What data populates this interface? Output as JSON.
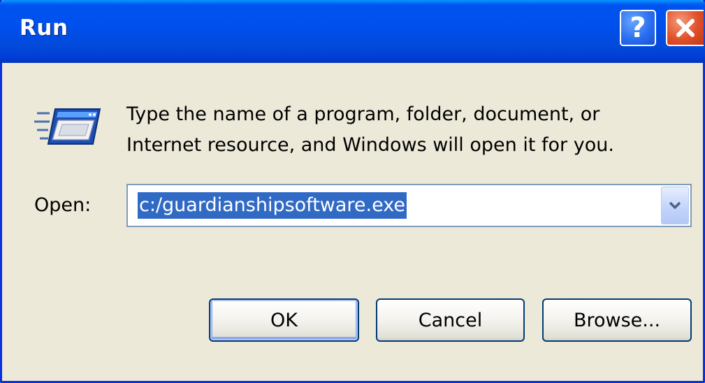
{
  "window": {
    "title": "Run",
    "help_glyph": "?",
    "close_icon": "close-icon"
  },
  "dialog": {
    "description_line1": "Type the name of a program, folder, document, or",
    "description_line2": "Internet resource, and Windows will open it for you.",
    "open_label": "Open:",
    "open_value": "c:/guardianshipsoftware.exe",
    "icon": "run-program-icon"
  },
  "buttons": {
    "ok": "OK",
    "cancel": "Cancel",
    "browse": "Browse..."
  },
  "colors": {
    "titlebar": "#0053ee",
    "window_bg": "#ece9d8",
    "selection": "#316ac5",
    "close_button": "#e0502a"
  }
}
